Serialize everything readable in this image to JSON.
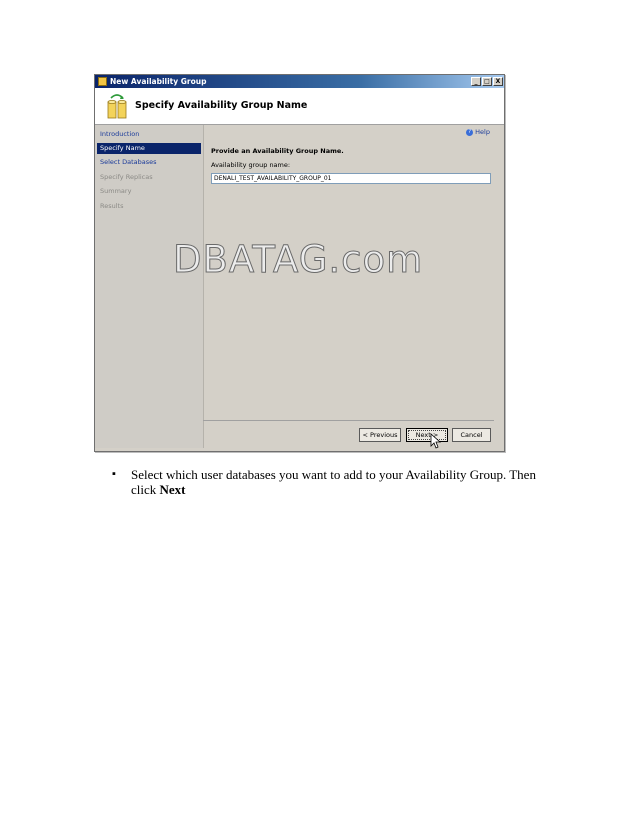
{
  "dialog": {
    "title": "New Availability Group",
    "header_title": "Specify Availability Group Name",
    "window_buttons": [
      "_",
      "□",
      "X"
    ]
  },
  "sidebar": {
    "items": [
      {
        "label": "Introduction",
        "state": "link"
      },
      {
        "label": "Specify Name",
        "state": "active"
      },
      {
        "label": "Select Databases",
        "state": "link"
      },
      {
        "label": "Specify Replicas",
        "state": "disabled"
      },
      {
        "label": "Summary",
        "state": "disabled"
      },
      {
        "label": "Results",
        "state": "disabled"
      }
    ]
  },
  "content": {
    "help_label": "Help",
    "heading": "Provide an Availability Group Name.",
    "field_label": "Availability group name:",
    "field_value": "DENALI_TEST_AVAILABILITY_GROUP_01"
  },
  "buttons": {
    "previous": "< Previous",
    "next": "Next >",
    "cancel": "Cancel"
  },
  "watermark": "DBATAG.com",
  "instruction": {
    "text_before": "Select which user databases you want to add to your Availability Group. Then click ",
    "bold_text": "Next"
  },
  "colors": {
    "titlebar": "#0a246a",
    "active_nav": "#0a246a",
    "link": "#1a3a9a",
    "dialog_bg": "#d4d0c8"
  }
}
